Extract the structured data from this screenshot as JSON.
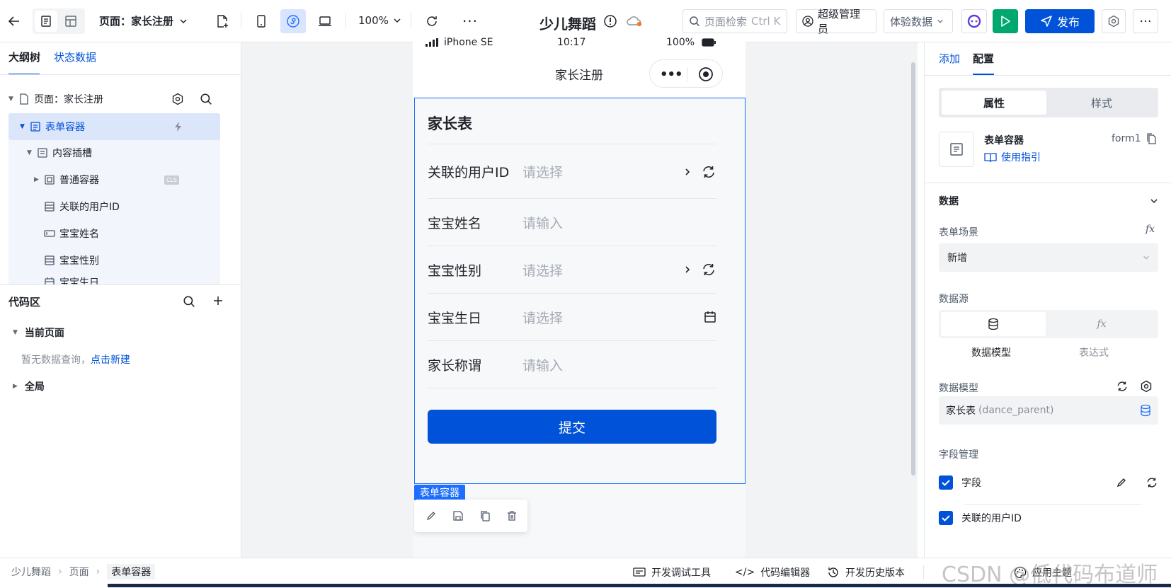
{
  "toolbar": {
    "page_selector": "页面：家长注册",
    "zoom": "100%",
    "app_name": "少儿舞蹈",
    "search_placeholder": "页面检索",
    "search_shortcut": "Ctrl K",
    "role": "超级管理员",
    "data_mode": "体验数据",
    "publish": "发布"
  },
  "left": {
    "tabs": [
      "大纲树",
      "状态数据"
    ],
    "tree": [
      {
        "label": "页面：家长注册"
      },
      {
        "label": "表单容器"
      },
      {
        "label": "内容插槽"
      },
      {
        "label": "普通容器",
        "badge": "CLS"
      },
      {
        "label": "关联的用户ID"
      },
      {
        "label": "宝宝姓名"
      },
      {
        "label": "宝宝性别"
      },
      {
        "label": "宝宝生日"
      }
    ],
    "code_title": "代码区",
    "current_page": "当前页面",
    "empty_text": "暂无数据查询，",
    "create_link": "点击新建",
    "global": "全局"
  },
  "phone": {
    "status_carrier": "iPhone SE",
    "status_time": "10:17",
    "status_battery": "100%",
    "title": "家长注册",
    "form_title": "家长表",
    "fields": [
      {
        "label": "关联的用户ID",
        "placeholder": "请选择",
        "kind": "select"
      },
      {
        "label": "宝宝姓名",
        "placeholder": "请输入",
        "kind": "input"
      },
      {
        "label": "宝宝性别",
        "placeholder": "请选择",
        "kind": "select"
      },
      {
        "label": "宝宝生日",
        "placeholder": "请选择",
        "kind": "date"
      },
      {
        "label": "家长称谓",
        "placeholder": "请输入",
        "kind": "input"
      }
    ],
    "submit": "提交",
    "selection_tag": "表单容器"
  },
  "right": {
    "tabs": [
      "添加",
      "配置"
    ],
    "segments": [
      "属性",
      "样式"
    ],
    "component_name": "表单容器",
    "component_id": "form1",
    "guide": "使用指引",
    "section_data": "数据",
    "scene_label": "表单场景",
    "scene_value": "新增",
    "source_label": "数据源",
    "source_options": [
      "数据模型",
      "表达式"
    ],
    "model_label": "数据模型",
    "model_value": "家长表",
    "model_code": "(dance_parent)",
    "field_mgmt": "字段管理",
    "field_check": "字段",
    "field_item": "关联的用户ID"
  },
  "bottom": {
    "breadcrumb": [
      "少儿舞蹈",
      "页面",
      "表单容器"
    ],
    "dev_tools": "开发调试工具",
    "code_editor": "代码编辑器",
    "history": "开发历史版本",
    "theme": "应用主题",
    "watermark": "CSDN @低代码布道师"
  },
  "colors": {
    "primary": "#0052d9",
    "green": "#00a870",
    "selection": "#1f6fff"
  }
}
